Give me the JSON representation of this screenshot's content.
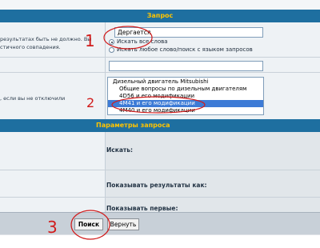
{
  "search_section": {
    "title": "Запрос",
    "note_lines": [
      "результатах быть не должно. Вы",
      "стичного совпадения."
    ],
    "keyword_value": "Дергается",
    "mode_options": [
      "Искать все слова",
      "Искать любое слово/поиск с языком запросов"
    ],
    "mode_selected": 0
  },
  "forum_section": {
    "note": ", если вы не отключили",
    "forums": [
      {
        "label": "Дизельный двигатель Mitsubishi",
        "selected": false
      },
      {
        "label": "Общие вопросы по дизельным двигателям",
        "selected": false
      },
      {
        "label": "4D56 и его модификации",
        "selected": false
      },
      {
        "label": "4M41 и его модификации",
        "selected": true
      },
      {
        "label": "4M40 и его модификации",
        "selected": false
      }
    ]
  },
  "params_section": {
    "title": "Параметры запроса",
    "fields": [
      "Искать:",
      "Показывать результаты как:",
      "Показывать первые:"
    ]
  },
  "buttons": {
    "search": "Поиск",
    "reset": "Вернуть"
  },
  "annotations": {
    "n1": "1",
    "n2": "2",
    "n3": "3"
  },
  "colors": {
    "header_bg": "#1e6fa0",
    "header_text": "#ffc400",
    "selection": "#3d7bd6",
    "annotation": "#d11b1b"
  }
}
